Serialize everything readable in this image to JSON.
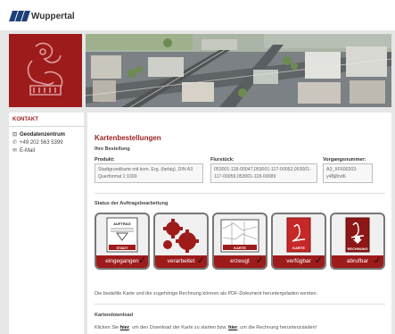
{
  "header": {
    "logo_text": "Wuppertal"
  },
  "sidebar": {
    "title": "KONTAKT",
    "items": [
      {
        "icon": "home-icon",
        "label": "Geodatenzentrum"
      },
      {
        "icon": "phone-icon",
        "label": "+49 202 563 5399"
      },
      {
        "icon": "mail-icon",
        "label": "E-Mail"
      }
    ]
  },
  "main": {
    "title": "Kartenbestellungen",
    "order_heading": "Ihre Bestellung",
    "columns": {
      "product": "Produkt:",
      "parcel": "Flurstück:",
      "process": "Vorgangsnummer:"
    },
    "values": {
      "product": "Stadtgrundkarte mit kom. Erg. (farbig), DIN A3 Querformat 1:1000",
      "parcel": "053001-118-00047,053001-117-00052,053001-117-00059,053001-118-00089",
      "process": "A3_XF600203-y4Bj8nd6"
    },
    "status_heading": "Status der Auftragsbearbeitung",
    "steps": [
      {
        "label": "eingegangen",
        "icon": "order-document-icon",
        "doc_top": "AUFTRAG",
        "doc_bottom": "STADT"
      },
      {
        "label": "verarbeitet",
        "icon": "gears-icon"
      },
      {
        "label": "erzeugt",
        "icon": "map-icon",
        "doc_top": "KARTE"
      },
      {
        "label": "verfügbar",
        "icon": "pdf-download-icon",
        "doc_bottom": "KARTE"
      },
      {
        "label": "abrufbar",
        "icon": "invoice-download-icon",
        "doc_bottom": "RECHNUNG"
      }
    ],
    "availability_text": "Die bestellte Karte und die zugehörige Rechnung können als PDF-Dokument heruntergeladen werden.",
    "download_heading": "Kartendownload",
    "download_text": {
      "part1": "Klicken Sie ",
      "link1": "hier",
      "part2": ", um den Download der Karte zu starten bzw. ",
      "link2": "hier",
      "part3": ", um die Rechnung herunterzuladen!"
    }
  },
  "colors": {
    "brand_red": "#9e1b1b",
    "brand_blue": "#1f3f7a"
  }
}
